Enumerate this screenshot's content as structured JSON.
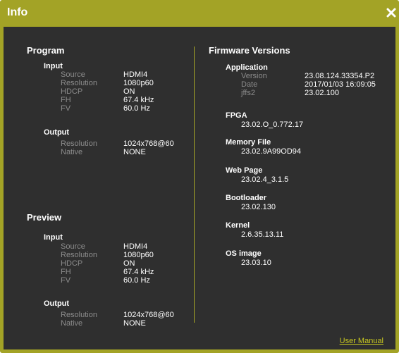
{
  "dialog": {
    "title": "Info",
    "close_icon": "close-icon",
    "accent_color": "#a3a326"
  },
  "program": {
    "title": "Program",
    "input": {
      "title": "Input",
      "rows": [
        {
          "label": "Source",
          "value": "HDMI4"
        },
        {
          "label": "Resolution",
          "value": "1080p60"
        },
        {
          "label": "HDCP",
          "value": "ON"
        },
        {
          "label": "FH",
          "value": "67.4 kHz"
        },
        {
          "label": "FV",
          "value": "60.0 Hz"
        }
      ]
    },
    "output": {
      "title": "Output",
      "rows": [
        {
          "label": "Resolution",
          "value": "1024x768@60"
        },
        {
          "label": "Native",
          "value": "NONE"
        }
      ]
    }
  },
  "preview": {
    "title": "Preview",
    "input": {
      "title": "Input",
      "rows": [
        {
          "label": "Source",
          "value": "HDMI4"
        },
        {
          "label": "Resolution",
          "value": "1080p60"
        },
        {
          "label": "HDCP",
          "value": "ON"
        },
        {
          "label": "FH",
          "value": "67.4 kHz"
        },
        {
          "label": "FV",
          "value": "60.0 Hz"
        }
      ]
    },
    "output": {
      "title": "Output",
      "rows": [
        {
          "label": "Resolution",
          "value": "1024x768@60"
        },
        {
          "label": "Native",
          "value": "NONE"
        }
      ]
    }
  },
  "firmware": {
    "title": "Firmware Versions",
    "application": {
      "title": "Application",
      "rows": [
        {
          "label": "Version",
          "value": "23.08.124.33354.P2"
        },
        {
          "label": "Date",
          "value": "2017/01/03 16:09:05"
        },
        {
          "label": "jffs2",
          "value": "23.02.100"
        }
      ]
    },
    "items": [
      {
        "name": "FPGA",
        "version": "23.02.O_0.772.17"
      },
      {
        "name": "Memory File",
        "version": "23.02.9A99OD94"
      },
      {
        "name": "Web Page",
        "version": "23.02.4_3.1.5"
      },
      {
        "name": "Bootloader",
        "version": "23.02.130"
      },
      {
        "name": "Kernel",
        "version": "2.6.35.13.11"
      },
      {
        "name": "OS image",
        "version": "23.03.10"
      }
    ]
  },
  "footer": {
    "user_manual": "User Manual"
  }
}
